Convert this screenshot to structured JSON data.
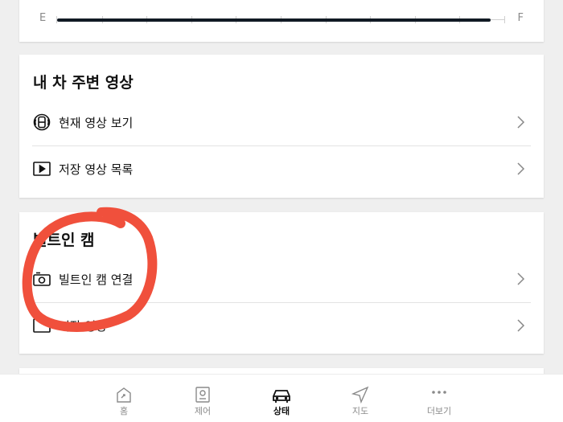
{
  "fuel": {
    "empty_label": "E",
    "full_label": "F",
    "level": 0.97
  },
  "camera_section": {
    "title": "내 차 주변 영상",
    "items": [
      {
        "label": "현재 영상 보기",
        "icon": "live-view-icon"
      },
      {
        "label": "저장 영상 목록",
        "icon": "video-play-icon"
      }
    ]
  },
  "builtin_section": {
    "title": "빌트인 캠",
    "items": [
      {
        "label": "빌트인 캠 연결",
        "icon": "dashcam-icon"
      },
      {
        "label": "저장 영상",
        "icon": "video-list-icon"
      }
    ]
  },
  "annotation": {
    "color": "#f0503c",
    "shape": "hand-drawn-circle"
  },
  "tabbar": {
    "active": "상태",
    "tabs": [
      {
        "label": "홈",
        "icon": "home-icon"
      },
      {
        "label": "제어",
        "icon": "control-icon"
      },
      {
        "label": "상태",
        "icon": "car-icon"
      },
      {
        "label": "지도",
        "icon": "navigation-icon"
      },
      {
        "label": "더보기",
        "icon": "more-icon"
      }
    ]
  }
}
